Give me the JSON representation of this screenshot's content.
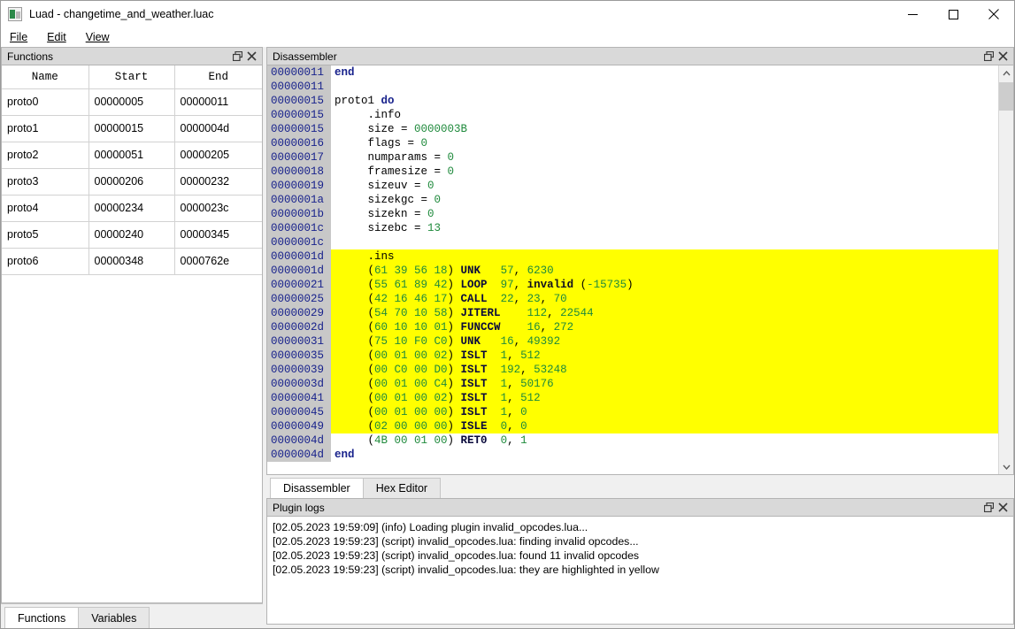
{
  "window": {
    "title": "Luad - changetime_and_weather.luac",
    "icon": "app-icon",
    "controls": {
      "minimize": "minimize-icon",
      "maximize": "maximize-icon",
      "close": "close-icon"
    }
  },
  "menubar": {
    "items": [
      {
        "label": "File",
        "accel": "F"
      },
      {
        "label": "Edit",
        "accel": "E"
      },
      {
        "label": "View",
        "accel": "V"
      }
    ]
  },
  "functions_panel": {
    "title": "Functions",
    "float_icon": "float-icon",
    "close_icon": "close-icon",
    "columns": [
      "Name",
      "Start",
      "End"
    ],
    "rows": [
      {
        "name": "proto0",
        "start": "00000005",
        "end": "00000011"
      },
      {
        "name": "proto1",
        "start": "00000015",
        "end": "0000004d"
      },
      {
        "name": "proto2",
        "start": "00000051",
        "end": "00000205"
      },
      {
        "name": "proto3",
        "start": "00000206",
        "end": "00000232"
      },
      {
        "name": "proto4",
        "start": "00000234",
        "end": "0000023c"
      },
      {
        "name": "proto5",
        "start": "00000240",
        "end": "00000345"
      },
      {
        "name": "proto6",
        "start": "00000348",
        "end": "0000762e"
      }
    ]
  },
  "left_tabs": [
    {
      "label": "Functions",
      "active": true
    },
    {
      "label": "Variables",
      "active": false
    }
  ],
  "disassembler_panel": {
    "title": "Disassembler",
    "float_icon": "float-icon",
    "close_icon": "close-icon",
    "scrollbar": {
      "up_icon": "chevron-up-icon",
      "down_icon": "chevron-down-icon",
      "thumb_position": "top"
    },
    "lines": [
      {
        "addr": "00000011",
        "highlight": false,
        "parts": [
          {
            "t": "end",
            "c": "kw"
          }
        ]
      },
      {
        "addr": "00000011",
        "highlight": false,
        "parts": []
      },
      {
        "addr": "00000015",
        "highlight": false,
        "parts": [
          {
            "t": "proto1 ",
            "c": "plain"
          },
          {
            "t": "do",
            "c": "kw"
          }
        ]
      },
      {
        "addr": "00000015",
        "highlight": false,
        "parts": [
          {
            "t": "     .info",
            "c": "plain"
          }
        ]
      },
      {
        "addr": "00000015",
        "highlight": false,
        "parts": [
          {
            "t": "     size = ",
            "c": "plain"
          },
          {
            "t": "0000003B",
            "c": "num"
          }
        ]
      },
      {
        "addr": "00000016",
        "highlight": false,
        "parts": [
          {
            "t": "     flags = ",
            "c": "plain"
          },
          {
            "t": "0",
            "c": "num"
          }
        ]
      },
      {
        "addr": "00000017",
        "highlight": false,
        "parts": [
          {
            "t": "     numparams = ",
            "c": "plain"
          },
          {
            "t": "0",
            "c": "num"
          }
        ]
      },
      {
        "addr": "00000018",
        "highlight": false,
        "parts": [
          {
            "t": "     framesize = ",
            "c": "plain"
          },
          {
            "t": "0",
            "c": "num"
          }
        ]
      },
      {
        "addr": "00000019",
        "highlight": false,
        "parts": [
          {
            "t": "     sizeuv = ",
            "c": "plain"
          },
          {
            "t": "0",
            "c": "num"
          }
        ]
      },
      {
        "addr": "0000001a",
        "highlight": false,
        "parts": [
          {
            "t": "     sizekgc = ",
            "c": "plain"
          },
          {
            "t": "0",
            "c": "num"
          }
        ]
      },
      {
        "addr": "0000001b",
        "highlight": false,
        "parts": [
          {
            "t": "     sizekn = ",
            "c": "plain"
          },
          {
            "t": "0",
            "c": "num"
          }
        ]
      },
      {
        "addr": "0000001c",
        "highlight": false,
        "parts": [
          {
            "t": "     sizebc = ",
            "c": "plain"
          },
          {
            "t": "13",
            "c": "num"
          }
        ]
      },
      {
        "addr": "0000001c",
        "highlight": false,
        "parts": []
      },
      {
        "addr": "0000001d",
        "highlight": true,
        "parts": [
          {
            "t": "     .ins",
            "c": "plain"
          }
        ]
      },
      {
        "addr": "0000001d",
        "highlight": true,
        "parts": [
          {
            "t": "     (",
            "c": "plain"
          },
          {
            "t": "61 39 56 18",
            "c": "num"
          },
          {
            "t": ") ",
            "c": "plain"
          },
          {
            "t": "UNK",
            "c": "op"
          },
          {
            "t": "   ",
            "c": "plain"
          },
          {
            "t": "57",
            "c": "num"
          },
          {
            "t": ", ",
            "c": "plain"
          },
          {
            "t": "6230",
            "c": "num"
          }
        ]
      },
      {
        "addr": "00000021",
        "highlight": true,
        "parts": [
          {
            "t": "     (",
            "c": "plain"
          },
          {
            "t": "55 61 89 42",
            "c": "num"
          },
          {
            "t": ") ",
            "c": "plain"
          },
          {
            "t": "LOOP",
            "c": "op"
          },
          {
            "t": "  ",
            "c": "plain"
          },
          {
            "t": "97",
            "c": "num"
          },
          {
            "t": ", ",
            "c": "plain"
          },
          {
            "t": "invalid",
            "c": "inv"
          },
          {
            "t": " (",
            "c": "plain"
          },
          {
            "t": "-15735",
            "c": "num"
          },
          {
            "t": ")",
            "c": "plain"
          }
        ]
      },
      {
        "addr": "00000025",
        "highlight": true,
        "parts": [
          {
            "t": "     (",
            "c": "plain"
          },
          {
            "t": "42 16 46 17",
            "c": "num"
          },
          {
            "t": ") ",
            "c": "plain"
          },
          {
            "t": "CALL",
            "c": "op"
          },
          {
            "t": "  ",
            "c": "plain"
          },
          {
            "t": "22",
            "c": "num"
          },
          {
            "t": ", ",
            "c": "plain"
          },
          {
            "t": "23",
            "c": "num"
          },
          {
            "t": ", ",
            "c": "plain"
          },
          {
            "t": "70",
            "c": "num"
          }
        ]
      },
      {
        "addr": "00000029",
        "highlight": true,
        "parts": [
          {
            "t": "     (",
            "c": "plain"
          },
          {
            "t": "54 70 10 58",
            "c": "num"
          },
          {
            "t": ") ",
            "c": "plain"
          },
          {
            "t": "JITERL",
            "c": "op"
          },
          {
            "t": "    ",
            "c": "plain"
          },
          {
            "t": "112",
            "c": "num"
          },
          {
            "t": ", ",
            "c": "plain"
          },
          {
            "t": "22544",
            "c": "num"
          }
        ]
      },
      {
        "addr": "0000002d",
        "highlight": true,
        "parts": [
          {
            "t": "     (",
            "c": "plain"
          },
          {
            "t": "60 10 10 01",
            "c": "num"
          },
          {
            "t": ") ",
            "c": "plain"
          },
          {
            "t": "FUNCCW",
            "c": "op"
          },
          {
            "t": "    ",
            "c": "plain"
          },
          {
            "t": "16",
            "c": "num"
          },
          {
            "t": ", ",
            "c": "plain"
          },
          {
            "t": "272",
            "c": "num"
          }
        ]
      },
      {
        "addr": "00000031",
        "highlight": true,
        "parts": [
          {
            "t": "     (",
            "c": "plain"
          },
          {
            "t": "75 10 F0 C0",
            "c": "num"
          },
          {
            "t": ") ",
            "c": "plain"
          },
          {
            "t": "UNK",
            "c": "op"
          },
          {
            "t": "   ",
            "c": "plain"
          },
          {
            "t": "16",
            "c": "num"
          },
          {
            "t": ", ",
            "c": "plain"
          },
          {
            "t": "49392",
            "c": "num"
          }
        ]
      },
      {
        "addr": "00000035",
        "highlight": true,
        "parts": [
          {
            "t": "     (",
            "c": "plain"
          },
          {
            "t": "00 01 00 02",
            "c": "num"
          },
          {
            "t": ") ",
            "c": "plain"
          },
          {
            "t": "ISLT",
            "c": "op"
          },
          {
            "t": "  ",
            "c": "plain"
          },
          {
            "t": "1",
            "c": "num"
          },
          {
            "t": ", ",
            "c": "plain"
          },
          {
            "t": "512",
            "c": "num"
          }
        ]
      },
      {
        "addr": "00000039",
        "highlight": true,
        "parts": [
          {
            "t": "     (",
            "c": "plain"
          },
          {
            "t": "00 C0 00 D0",
            "c": "num"
          },
          {
            "t": ") ",
            "c": "plain"
          },
          {
            "t": "ISLT",
            "c": "op"
          },
          {
            "t": "  ",
            "c": "plain"
          },
          {
            "t": "192",
            "c": "num"
          },
          {
            "t": ", ",
            "c": "plain"
          },
          {
            "t": "53248",
            "c": "num"
          }
        ]
      },
      {
        "addr": "0000003d",
        "highlight": true,
        "parts": [
          {
            "t": "     (",
            "c": "plain"
          },
          {
            "t": "00 01 00 C4",
            "c": "num"
          },
          {
            "t": ") ",
            "c": "plain"
          },
          {
            "t": "ISLT",
            "c": "op"
          },
          {
            "t": "  ",
            "c": "plain"
          },
          {
            "t": "1",
            "c": "num"
          },
          {
            "t": ", ",
            "c": "plain"
          },
          {
            "t": "50176",
            "c": "num"
          }
        ]
      },
      {
        "addr": "00000041",
        "highlight": true,
        "parts": [
          {
            "t": "     (",
            "c": "plain"
          },
          {
            "t": "00 01 00 02",
            "c": "num"
          },
          {
            "t": ") ",
            "c": "plain"
          },
          {
            "t": "ISLT",
            "c": "op"
          },
          {
            "t": "  ",
            "c": "plain"
          },
          {
            "t": "1",
            "c": "num"
          },
          {
            "t": ", ",
            "c": "plain"
          },
          {
            "t": "512",
            "c": "num"
          }
        ]
      },
      {
        "addr": "00000045",
        "highlight": true,
        "parts": [
          {
            "t": "     (",
            "c": "plain"
          },
          {
            "t": "00 01 00 00",
            "c": "num"
          },
          {
            "t": ") ",
            "c": "plain"
          },
          {
            "t": "ISLT",
            "c": "op"
          },
          {
            "t": "  ",
            "c": "plain"
          },
          {
            "t": "1",
            "c": "num"
          },
          {
            "t": ", ",
            "c": "plain"
          },
          {
            "t": "0",
            "c": "num"
          }
        ]
      },
      {
        "addr": "00000049",
        "highlight": true,
        "parts": [
          {
            "t": "     (",
            "c": "plain"
          },
          {
            "t": "02 00 00 00",
            "c": "num"
          },
          {
            "t": ") ",
            "c": "plain"
          },
          {
            "t": "ISLE",
            "c": "op"
          },
          {
            "t": "  ",
            "c": "plain"
          },
          {
            "t": "0",
            "c": "num"
          },
          {
            "t": ", ",
            "c": "plain"
          },
          {
            "t": "0",
            "c": "num"
          }
        ]
      },
      {
        "addr": "0000004d",
        "highlight": false,
        "parts": [
          {
            "t": "     (",
            "c": "plain"
          },
          {
            "t": "4B 00 01 00",
            "c": "num"
          },
          {
            "t": ") ",
            "c": "plain"
          },
          {
            "t": "RET0",
            "c": "op"
          },
          {
            "t": "  ",
            "c": "plain"
          },
          {
            "t": "0",
            "c": "num"
          },
          {
            "t": ", ",
            "c": "plain"
          },
          {
            "t": "1",
            "c": "num"
          }
        ]
      },
      {
        "addr": "0000004d",
        "highlight": false,
        "parts": [
          {
            "t": "end",
            "c": "kw"
          }
        ]
      }
    ]
  },
  "disassembler_tabs": [
    {
      "label": "Disassembler",
      "active": true
    },
    {
      "label": "Hex Editor",
      "active": false
    }
  ],
  "plugin_logs_panel": {
    "title": "Plugin logs",
    "float_icon": "float-icon",
    "close_icon": "close-icon",
    "lines": [
      "[02.05.2023 19:59:09] (info) Loading plugin invalid_opcodes.lua...",
      "[02.05.2023 19:59:23] (script) invalid_opcodes.lua: finding invalid opcodes...",
      "[02.05.2023 19:59:23] (script) invalid_opcodes.lua: found 11 invalid opcodes",
      "[02.05.2023 19:59:23] (script) invalid_opcodes.lua: they are highlighted in yellow"
    ]
  },
  "colors": {
    "highlight": "#ffff00",
    "gutter": "#c8c8c8",
    "address_text": "#18228c",
    "keyword": "#18228c",
    "number": "#1f8a3c",
    "panel_header": "#d9d9d9",
    "window_bg": "#f0f0f0"
  }
}
